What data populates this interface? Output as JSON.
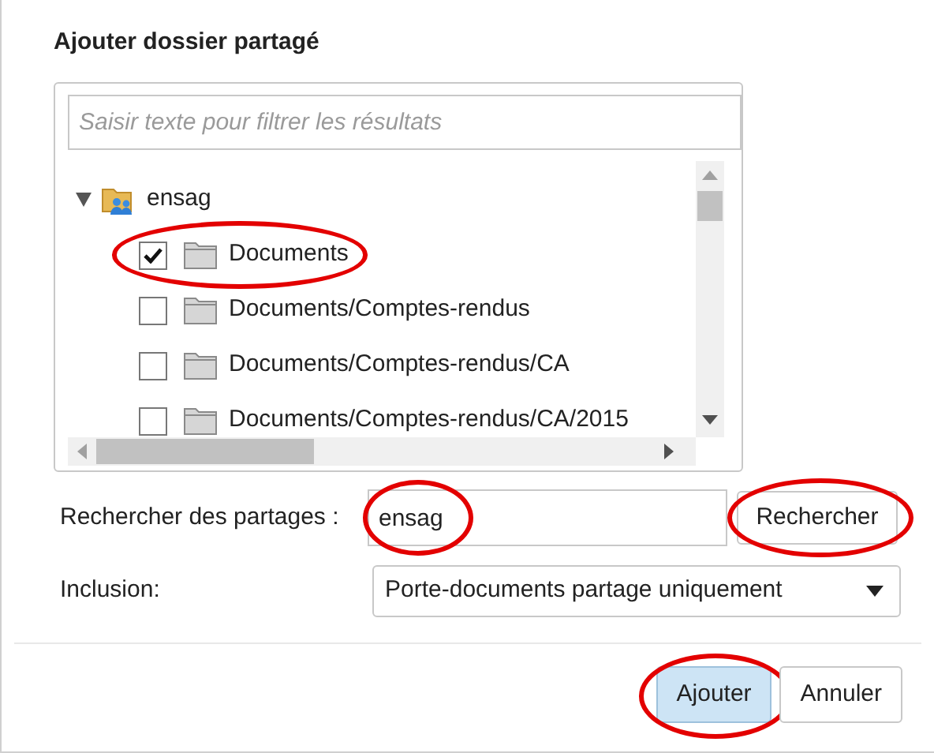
{
  "dialog": {
    "title": "Ajouter dossier partagé"
  },
  "filter": {
    "placeholder": "Saisir texte pour filtrer les résultats"
  },
  "tree": [
    {
      "label": "ensag",
      "kind": "share",
      "expanded": true,
      "children": [
        {
          "label": "Documents",
          "kind": "folder",
          "checked": true,
          "highlighted": true
        },
        {
          "label": "Documents/Comptes-rendus",
          "kind": "folder",
          "checked": false,
          "highlighted": false
        },
        {
          "label": "Documents/Comptes-rendus/CA",
          "kind": "folder",
          "checked": false,
          "highlighted": false
        },
        {
          "label": "Documents/Comptes-rendus/CA/2015",
          "kind": "folder",
          "checked": false,
          "highlighted": false
        }
      ]
    }
  ],
  "search": {
    "label": "Rechercher des partages :",
    "value": "ensag",
    "highlighted": true,
    "button": {
      "label": "Rechercher",
      "highlighted": true
    }
  },
  "inclusion": {
    "label": "Inclusion:",
    "value": "Porte-documents partage uniquement"
  },
  "buttons": [
    {
      "label": "Ajouter",
      "primary": true,
      "highlighted": true
    },
    {
      "label": "Annuler",
      "primary": false,
      "highlighted": false
    }
  ]
}
